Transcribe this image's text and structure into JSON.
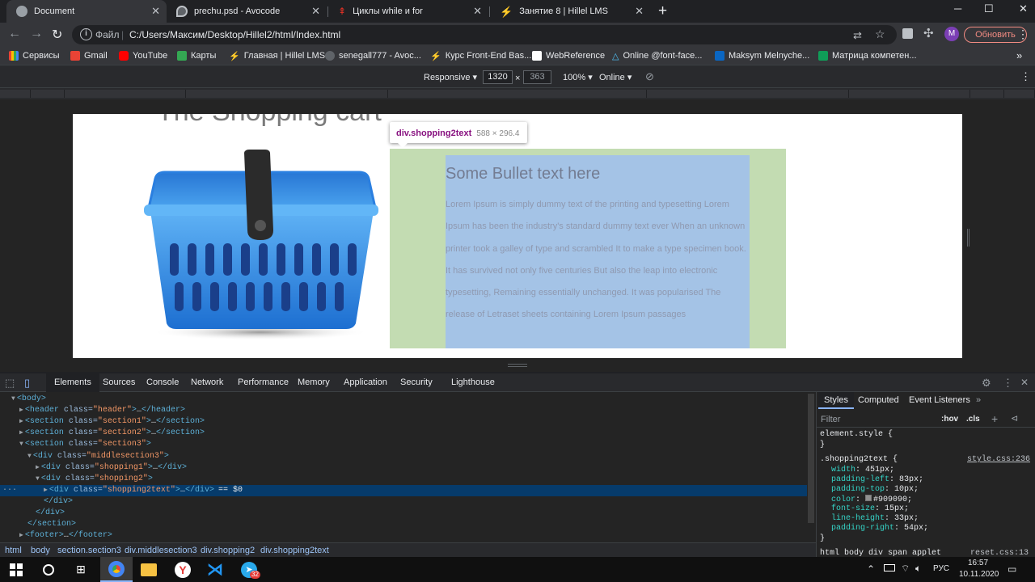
{
  "tabs": [
    {
      "title": "Document",
      "favicon_color": "#9aa0a6"
    },
    {
      "title": "prechu.psd - Avocode",
      "favicon_color": "#bdc1c6"
    },
    {
      "title": "Циклы while и for",
      "favicon_color": "#d93025"
    },
    {
      "title": "Занятие 8 | Hillel LMS",
      "favicon_color": "#1a73e8"
    }
  ],
  "toolbar": {
    "scheme": "Файл",
    "url": "C:/Users/Максим/Desktop/Hillel2/html/Index.html",
    "avatar_letter": "M",
    "update_label": "Обновить"
  },
  "bookmarks": [
    {
      "label": "Сервисы",
      "color": "#ea4335"
    },
    {
      "label": "Gmail",
      "color": "#ea4335"
    },
    {
      "label": "YouTube",
      "color": "#ff0000"
    },
    {
      "label": "Карты",
      "color": "#34a853"
    },
    {
      "label": "Главная | Hillel LMS",
      "color": "#1a73e8"
    },
    {
      "label": "senegall777 - Avoc...",
      "color": "#bdc1c6"
    },
    {
      "label": "Курс Front-End Bas...",
      "color": "#7cb342"
    },
    {
      "label": "WebReference",
      "color": "#ffffff"
    },
    {
      "label": "Online @font-face...",
      "color": "#4fc3f7"
    },
    {
      "label": "Maksym Melnyche...",
      "color": "#0a66c2"
    },
    {
      "label": "Матрица компетен...",
      "color": "#0f9d58"
    }
  ],
  "device_toolbar": {
    "mode": "Responsive",
    "width": "1320",
    "times": "×",
    "height": "363",
    "zoom": "100%",
    "network": "Online"
  },
  "page": {
    "cart_title": "The Shopping cart",
    "bullet_title": "Some Bullet text here",
    "bullet_body": "Lorem Ipsum is simply dummy text of the printing and typesetting Lorem Ipsum has been the industry's standard dummy text ever When an unknown printer took a galley of type and scrambled It to make a type specimen book. It has survived not only five centuries But also the leap into electronic typesetting, Remaining essentially unchanged. It was popularised The release of Letraset sheets containing Lorem Ipsum passages"
  },
  "inspector_tooltip": {
    "selector": "div.shopping2text",
    "size": "588 × 296.4"
  },
  "devtools": {
    "tabs": [
      "Elements",
      "Sources",
      "Console",
      "Network",
      "Performance",
      "Memory",
      "Application",
      "Security",
      "Lighthouse"
    ],
    "dom_lines": [
      {
        "indent": 0,
        "open": true,
        "tag": "<body>",
        "cls": ""
      },
      {
        "indent": 1,
        "open": false,
        "tag": "header",
        "cls": "header"
      },
      {
        "indent": 1,
        "open": false,
        "tag": "section",
        "cls": "section1"
      },
      {
        "indent": 1,
        "open": false,
        "tag": "section",
        "cls": "section2"
      },
      {
        "indent": 1,
        "open": true,
        "tag": "section",
        "cls": "section3"
      },
      {
        "indent": 2,
        "open": true,
        "tag": "div",
        "cls": "middlesection3"
      },
      {
        "indent": 3,
        "open": false,
        "tag": "div",
        "cls": "shopping1"
      },
      {
        "indent": 3,
        "open": true,
        "tag": "div",
        "cls": "shopping2"
      },
      {
        "indent": 4,
        "open": false,
        "tag": "div",
        "cls": "shopping2text",
        "selected": true
      },
      {
        "indent": 3,
        "close": "</div>"
      },
      {
        "indent": 2,
        "close": "</div>"
      },
      {
        "indent": 1,
        "close": "</section>"
      },
      {
        "indent": 1,
        "open": false,
        "tag": "footer",
        "cls": ""
      }
    ],
    "selected_suffix": "== $0",
    "breadcrumbs": [
      "html",
      "body",
      "section.section3",
      "div.middlesection3",
      "div.shopping2",
      "div.shopping2text"
    ]
  },
  "styles_pane": {
    "tabs": [
      "Styles",
      "Computed",
      "Event Listeners"
    ],
    "filter_placeholder": "Filter",
    "hov": ":hov",
    "cls": ".cls",
    "element_style": "element.style {",
    "rule_selector": ".shopping2text {",
    "rule_source": "style.css:236",
    "declarations": [
      {
        "prop": "width",
        "value": "451px;"
      },
      {
        "prop": "padding-left",
        "value": "83px;"
      },
      {
        "prop": "padding-top",
        "value": "10px;"
      },
      {
        "prop": "color",
        "value": "#909090;"
      },
      {
        "prop": "font-size",
        "value": "15px;"
      },
      {
        "prop": "line-height",
        "value": "33px;"
      },
      {
        "prop": "padding-right",
        "value": "54px;"
      }
    ],
    "bottom_crumbs": "html  body  div  span  applet",
    "bottom_source": "reset.css:13"
  },
  "taskbar": {
    "lang": "РУС",
    "time": "16:57",
    "date": "10.11.2020",
    "telegram_badge": "32"
  },
  "colors": {
    "highlight_padding": "#c3dcb2",
    "highlight_content": "#a4c3e6",
    "tag": "#5db0d7",
    "attr_value": "#f29766"
  }
}
